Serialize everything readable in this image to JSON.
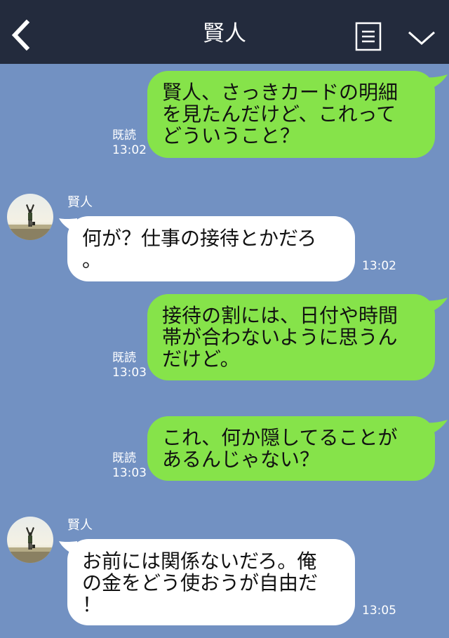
{
  "header": {
    "title": "賢人",
    "back_icon": "chevron-left-icon",
    "menu_icon": "document-list-icon",
    "expand_icon": "chevron-down-icon",
    "background": "#232b3d"
  },
  "chat_background": "#7291c2",
  "sent_bubble_color": "#86e34a",
  "received_bubble_color": "#ffffff",
  "messages": [
    {
      "type": "sent",
      "lines": [
        "賢人、さっきカードの明細",
        "を見たんだけど、これって",
        "どういうこと？"
      ],
      "read_label": "既読",
      "time": "13:02"
    },
    {
      "type": "received",
      "sender": "賢人",
      "avatar": "person-arms-raised-avatar",
      "lines": [
        "何が？仕事の接待とかだろ",
        "。"
      ],
      "time": "13:02"
    },
    {
      "type": "sent",
      "lines": [
        "接待の割には、日付や時間",
        "帯が合わないように思うん",
        "だけど。"
      ],
      "read_label": "既読",
      "time": "13:03"
    },
    {
      "type": "sent",
      "lines": [
        "これ、何か隠してることが",
        "あるんじゃない？"
      ],
      "read_label": "既読",
      "time": "13:03"
    },
    {
      "type": "received",
      "sender": "賢人",
      "avatar": "person-arms-raised-avatar",
      "lines": [
        "お前には関係ないだろ。俺",
        "の金をどう使おうが自由だ",
        "！"
      ],
      "time": "13:05"
    }
  ]
}
